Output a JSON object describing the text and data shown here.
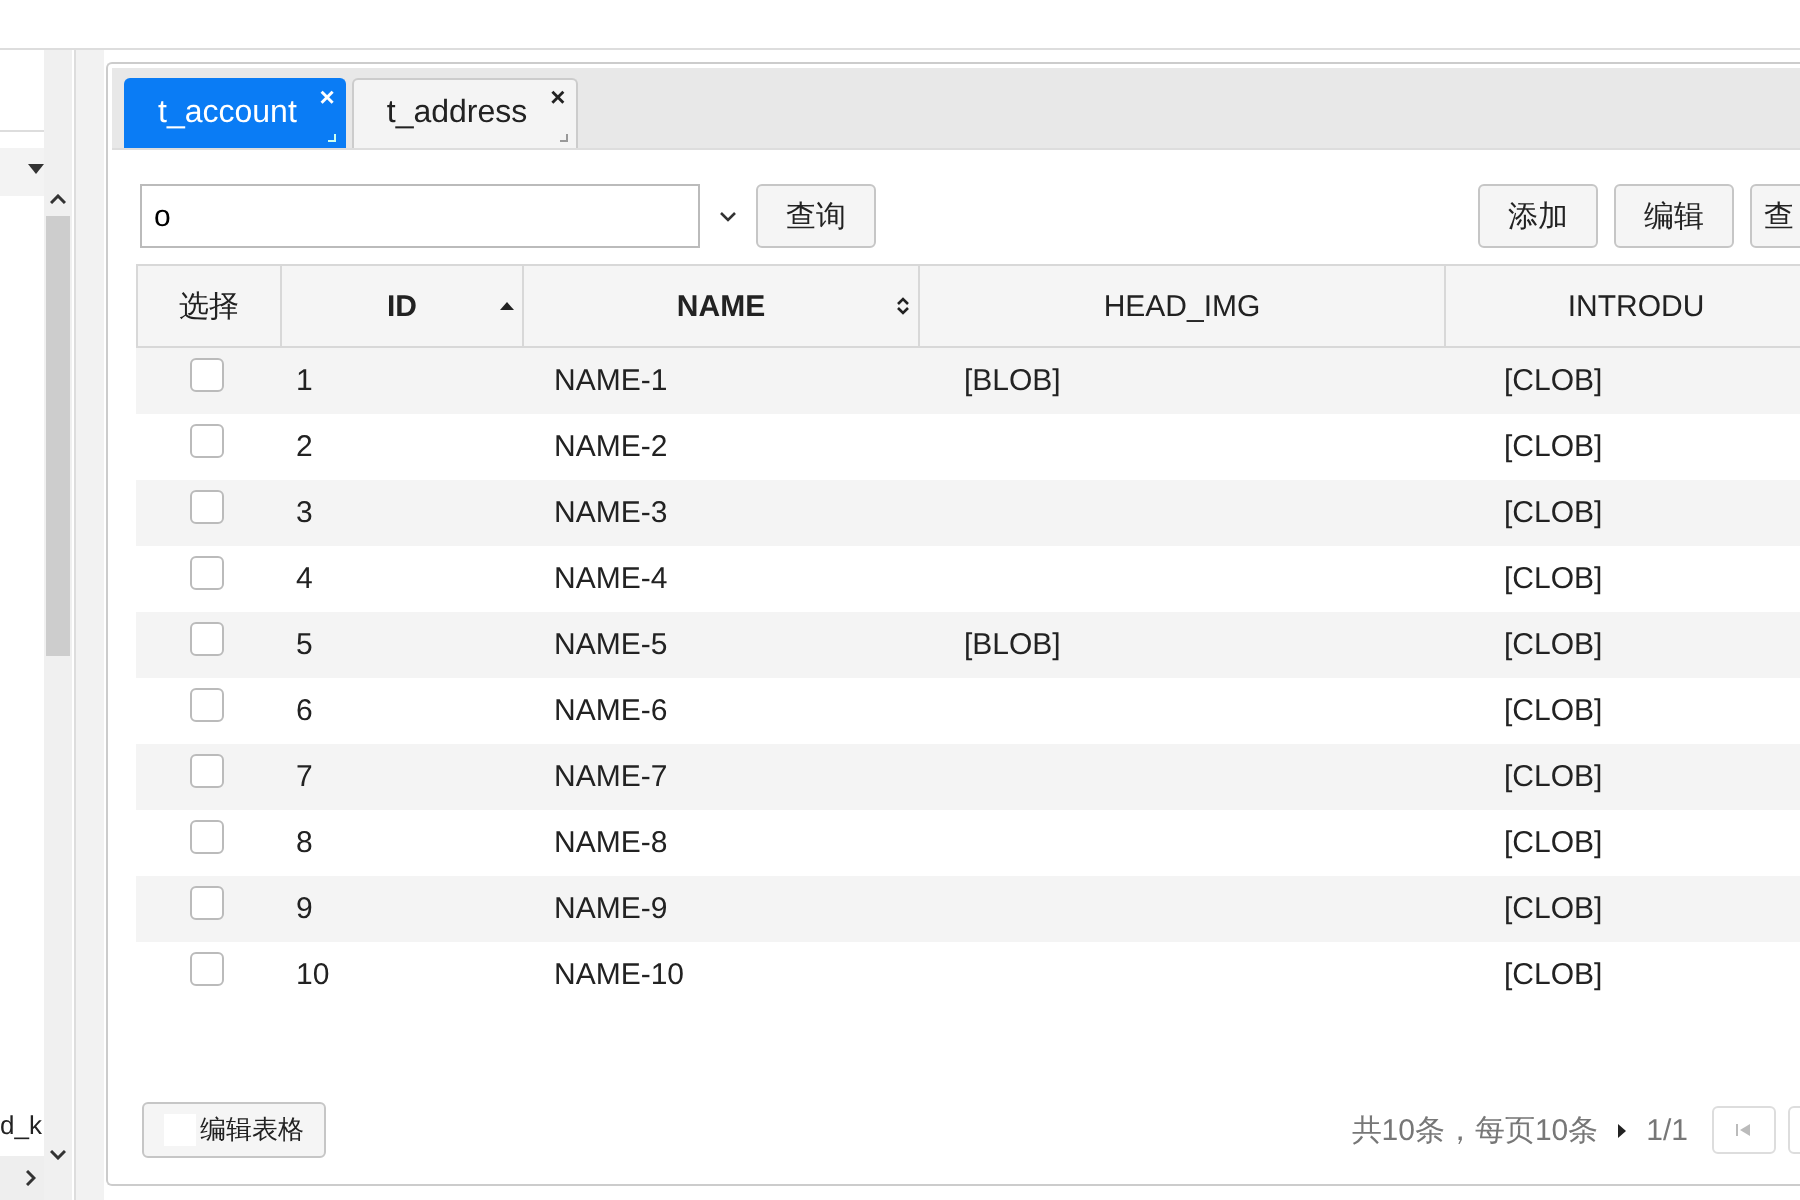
{
  "sidebar": {
    "partial_text": "d_k"
  },
  "tabs": [
    {
      "label": "t_account",
      "close": "×",
      "selected": true
    },
    {
      "label": "t_address",
      "close": "×",
      "selected": false
    }
  ],
  "search": {
    "value": "o"
  },
  "query_button": "查询",
  "toolbar_buttons": [
    "添加",
    "编辑",
    "查"
  ],
  "table": {
    "columns": [
      {
        "label": "选择",
        "kind": "plain"
      },
      {
        "label": "ID",
        "kind": "sorted"
      },
      {
        "label": "NAME",
        "kind": "sortable"
      },
      {
        "label": "HEAD_IMG",
        "kind": "plain"
      },
      {
        "label": "INTRODU",
        "kind": "plain"
      }
    ],
    "rows": [
      {
        "checked": false,
        "id": "1",
        "name": "NAME-1",
        "head_img": "[BLOB]",
        "intro": "[CLOB]"
      },
      {
        "checked": false,
        "id": "2",
        "name": "NAME-2",
        "head_img": "",
        "intro": "[CLOB]"
      },
      {
        "checked": false,
        "id": "3",
        "name": "NAME-3",
        "head_img": "",
        "intro": "[CLOB]"
      },
      {
        "checked": false,
        "id": "4",
        "name": "NAME-4",
        "head_img": "",
        "intro": "[CLOB]"
      },
      {
        "checked": false,
        "id": "5",
        "name": "NAME-5",
        "head_img": "[BLOB]",
        "intro": "[CLOB]"
      },
      {
        "checked": false,
        "id": "6",
        "name": "NAME-6",
        "head_img": "",
        "intro": "[CLOB]"
      },
      {
        "checked": false,
        "id": "7",
        "name": "NAME-7",
        "head_img": "",
        "intro": "[CLOB]"
      },
      {
        "checked": false,
        "id": "8",
        "name": "NAME-8",
        "head_img": "",
        "intro": "[CLOB]"
      },
      {
        "checked": false,
        "id": "9",
        "name": "NAME-9",
        "head_img": "",
        "intro": "[CLOB]"
      },
      {
        "checked": false,
        "id": "10",
        "name": "NAME-10",
        "head_img": "",
        "intro": "[CLOB]"
      }
    ]
  },
  "edit_table_button": "编辑表格",
  "pagination": {
    "summary": "共10条，每页10条",
    "page": "1/1"
  }
}
